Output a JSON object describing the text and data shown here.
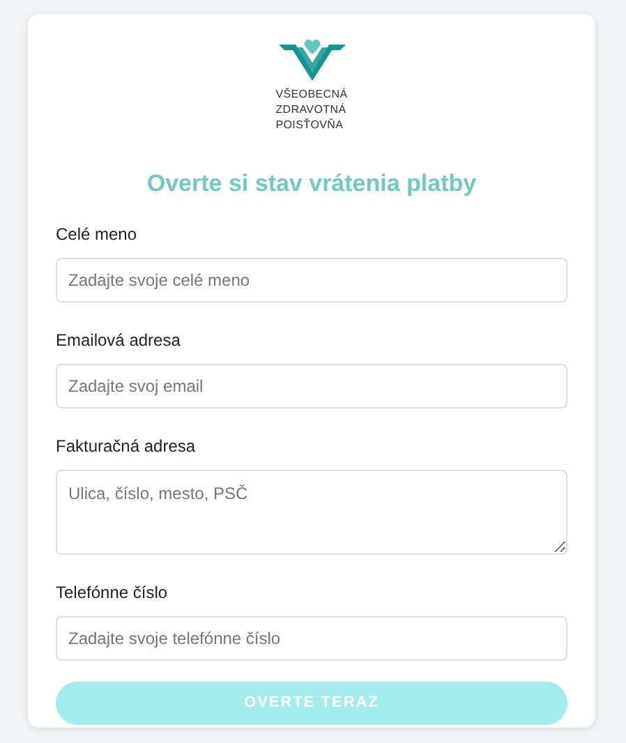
{
  "logo": {
    "lines": [
      "VŠEOBECNÁ",
      "ZDRAVOTNÁ",
      "POISŤOVŇA"
    ]
  },
  "title": "Overte si stav vrátenia platby",
  "fields": [
    {
      "kind": "input",
      "label": "Celé meno",
      "placeholder": "Zadajte svoje celé meno"
    },
    {
      "kind": "input",
      "label": "Emailová adresa",
      "placeholder": "Zadajte svoj email"
    },
    {
      "kind": "textarea",
      "label": "Fakturačná adresa",
      "placeholder": "Ulica, číslo, mesto, PSČ"
    },
    {
      "kind": "input",
      "label": "Telefónne číslo",
      "placeholder": "Zadajte svoje telefónne číslo"
    }
  ],
  "submit": "OVERTE TERAZ"
}
